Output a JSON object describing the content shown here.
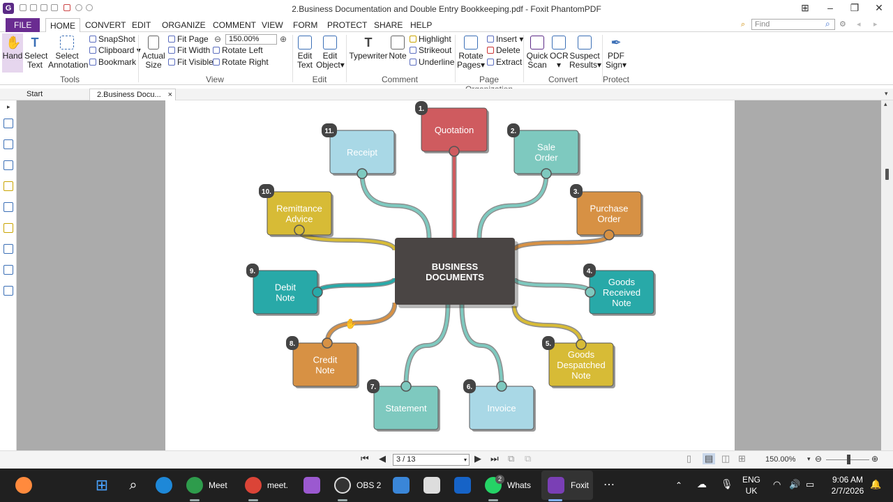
{
  "titlebar": {
    "title": "2.Business Documentation and Double Entry Bookkeeping.pdf - Foxit PhantomPDF",
    "logo": "G"
  },
  "menu": {
    "file": "FILE",
    "tabs": [
      "HOME",
      "CONVERT",
      "EDIT",
      "ORGANIZE",
      "COMMENT",
      "VIEW",
      "FORM",
      "PROTECT",
      "SHARE",
      "HELP"
    ],
    "active": "HOME",
    "find_placeholder": "Find"
  },
  "ribbon": {
    "tools": {
      "hand": "Hand",
      "select_text_1": "Select",
      "select_text_2": "Text",
      "select_ann_1": "Select",
      "select_ann_2": "Annotation",
      "snapshot": "SnapShot",
      "clipboard": "Clipboard",
      "bookmark": "Bookmark",
      "label": "Tools"
    },
    "view": {
      "actual_1": "Actual",
      "actual_2": "Size",
      "fit_page": "Fit Page",
      "fit_width": "Fit Width",
      "fit_visible": "Fit Visible",
      "zoom": "150.00%",
      "rotate_left": "Rotate Left",
      "rotate_right": "Rotate Right",
      "label": "View"
    },
    "edit": {
      "edit_text_1": "Edit",
      "edit_text_2": "Text",
      "edit_obj_1": "Edit",
      "edit_obj_2": "Object",
      "label": "Edit"
    },
    "comment": {
      "typewriter": "Typewriter",
      "note": "Note",
      "highlight": "Highlight",
      "strikeout": "Strikeout",
      "underline": "Underline",
      "label": "Comment"
    },
    "page_org": {
      "rotate_1": "Rotate",
      "rotate_2": "Pages",
      "insert": "Insert",
      "delete": "Delete",
      "extract": "Extract",
      "label": "Page Organization"
    },
    "convert": {
      "quick_1": "Quick",
      "quick_2": "Scan",
      "ocr": "OCR",
      "suspect_1": "Suspect",
      "suspect_2": "Results",
      "label": "Convert"
    },
    "protect": {
      "pdf_1": "PDF",
      "pdf_2": "Sign",
      "label": "Protect"
    }
  },
  "tabs": {
    "start": "Start",
    "doc": "2.Business Docu..."
  },
  "diagram": {
    "center_line1": "BUSINESS",
    "center_line2": "DOCUMENTS",
    "nodes": [
      {
        "num": "1.",
        "line1": "Quotation",
        "line2": "",
        "line3": "",
        "color": "#cf5b5f"
      },
      {
        "num": "2.",
        "line1": "Sale",
        "line2": "Order",
        "line3": "",
        "color": "#7ec9bf"
      },
      {
        "num": "3.",
        "line1": "Purchase",
        "line2": "Order",
        "line3": "",
        "color": "#d79144"
      },
      {
        "num": "4.",
        "line1": "Goods",
        "line2": "Received",
        "line3": "Note",
        "color": "#28a9a8"
      },
      {
        "num": "5.",
        "line1": "Goods",
        "line2": "Despatched",
        "line3": "Note",
        "color": "#d7bb36"
      },
      {
        "num": "6.",
        "line1": "Invoice",
        "line2": "",
        "line3": "",
        "color": "#a9d8e6"
      },
      {
        "num": "7.",
        "line1": "Statement",
        "line2": "",
        "line3": "",
        "color": "#7ec9bf"
      },
      {
        "num": "8.",
        "line1": "Credit",
        "line2": "Note",
        "line3": "",
        "color": "#d79144"
      },
      {
        "num": "9.",
        "line1": "Debit",
        "line2": "Note",
        "line3": "",
        "color": "#28a9a8"
      },
      {
        "num": "10.",
        "line1": "Remittance",
        "line2": "Advice",
        "line3": "",
        "color": "#d7bb36"
      },
      {
        "num": "11.",
        "line1": "Receipt",
        "line2": "",
        "line3": "",
        "color": "#a9d8e6"
      }
    ]
  },
  "status": {
    "page": "3 / 13",
    "zoom": "150.00%"
  },
  "taskbar": {
    "meet": "Meet",
    "meet2": "meet.",
    "obs": "OBS 2",
    "whats": "Whats",
    "foxit": "Foxit",
    "lang1": "ENG",
    "lang2": "UK",
    "time": "9:06 AM",
    "date": "2/7/2026",
    "whats_badge": "2"
  }
}
